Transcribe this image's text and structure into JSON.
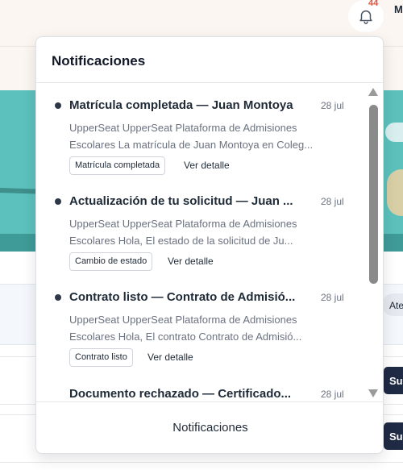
{
  "topbar": {
    "notification_count": "44",
    "user_initial": "M"
  },
  "background": {
    "pill_label": "Ate",
    "button_label_1": "Su",
    "button_label_2": "Su"
  },
  "dropdown": {
    "title": "Notificaciones",
    "footer_label": "Notificaciones",
    "items": [
      {
        "title": "Matrícula completada — Juan Montoya",
        "date": "28 jul",
        "body_line1": "UpperSeat UpperSeat Plataforma de Admisiones",
        "body_line2": "Escolares La matrícula de Juan Montoya en Coleg...",
        "tag": "Matrícula completada",
        "link": "Ver detalle",
        "unread": true
      },
      {
        "title": "Actualización de tu solicitud — Juan ...",
        "date": "28 jul",
        "body_line1": "UpperSeat UpperSeat Plataforma de Admisiones",
        "body_line2": "Escolares Hola, El estado de la solicitud de Ju...",
        "tag": "Cambio de estado",
        "link": "Ver detalle",
        "unread": true
      },
      {
        "title": "Contrato listo — Contrato de Admisió...",
        "date": "28 jul",
        "body_line1": "UpperSeat UpperSeat Plataforma de Admisiones",
        "body_line2": "Escolares Hola, El contrato Contrato de Admisió...",
        "tag": "Contrato listo",
        "link": "Ver detalle",
        "unread": true
      },
      {
        "title": "Documento rechazado — Certificado...",
        "date": "28 jul",
        "unread": false
      }
    ]
  },
  "colors": {
    "hero_teal": "#5cc1bc",
    "badge_red": "#e5533d",
    "dark_navy": "#1f2a44"
  }
}
